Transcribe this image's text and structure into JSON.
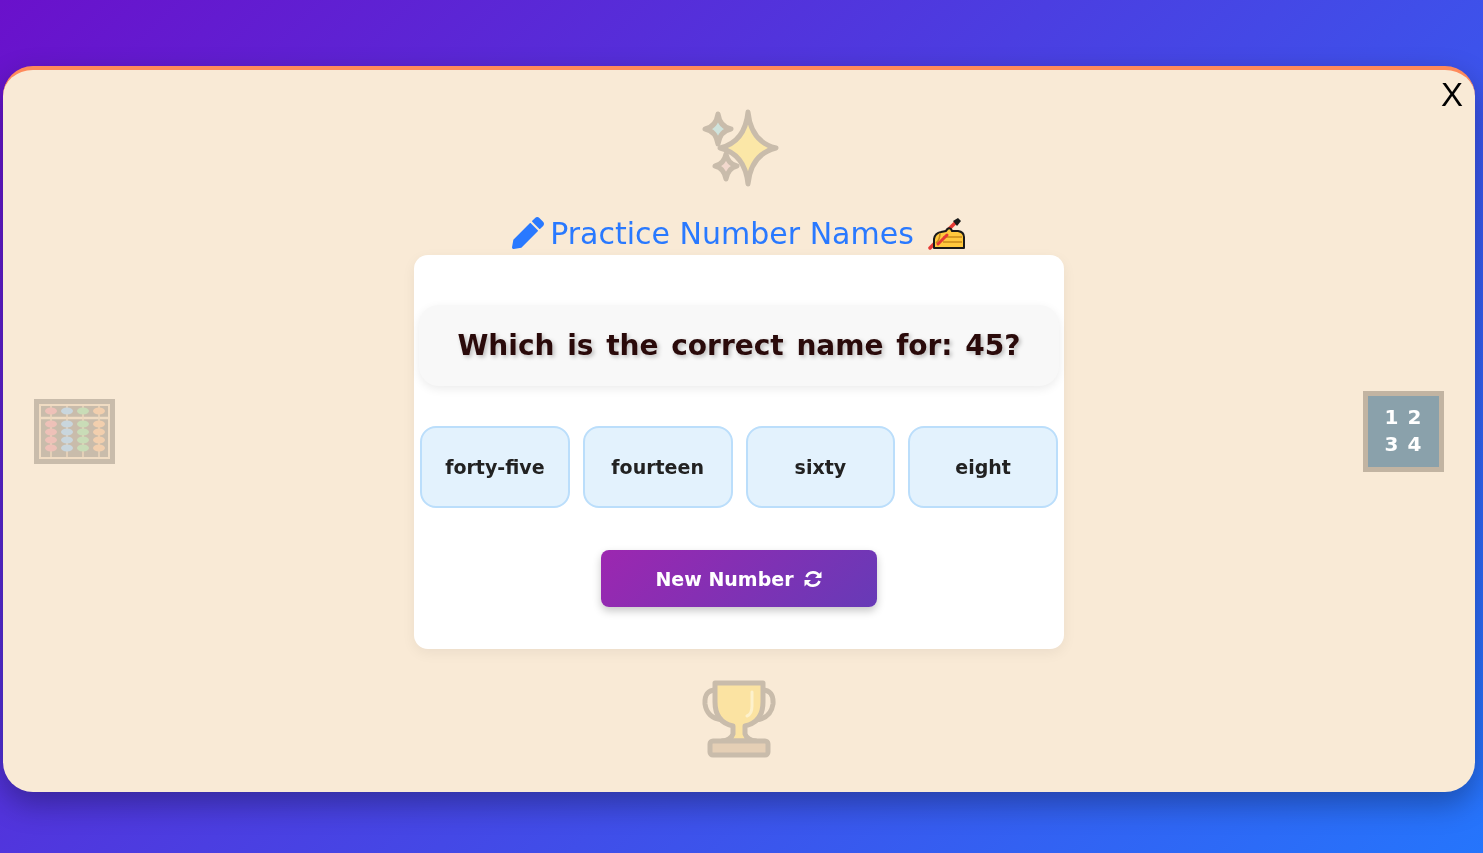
{
  "modal": {
    "close": "X"
  },
  "decor": {
    "number_tile": [
      "1 2",
      "3 4"
    ]
  },
  "title": "Practice Number Names",
  "quiz": {
    "question": "Which is the correct name for: 45?",
    "options": [
      "forty-five",
      "fourteen",
      "sixty",
      "eight"
    ],
    "new_button": "New Number"
  }
}
